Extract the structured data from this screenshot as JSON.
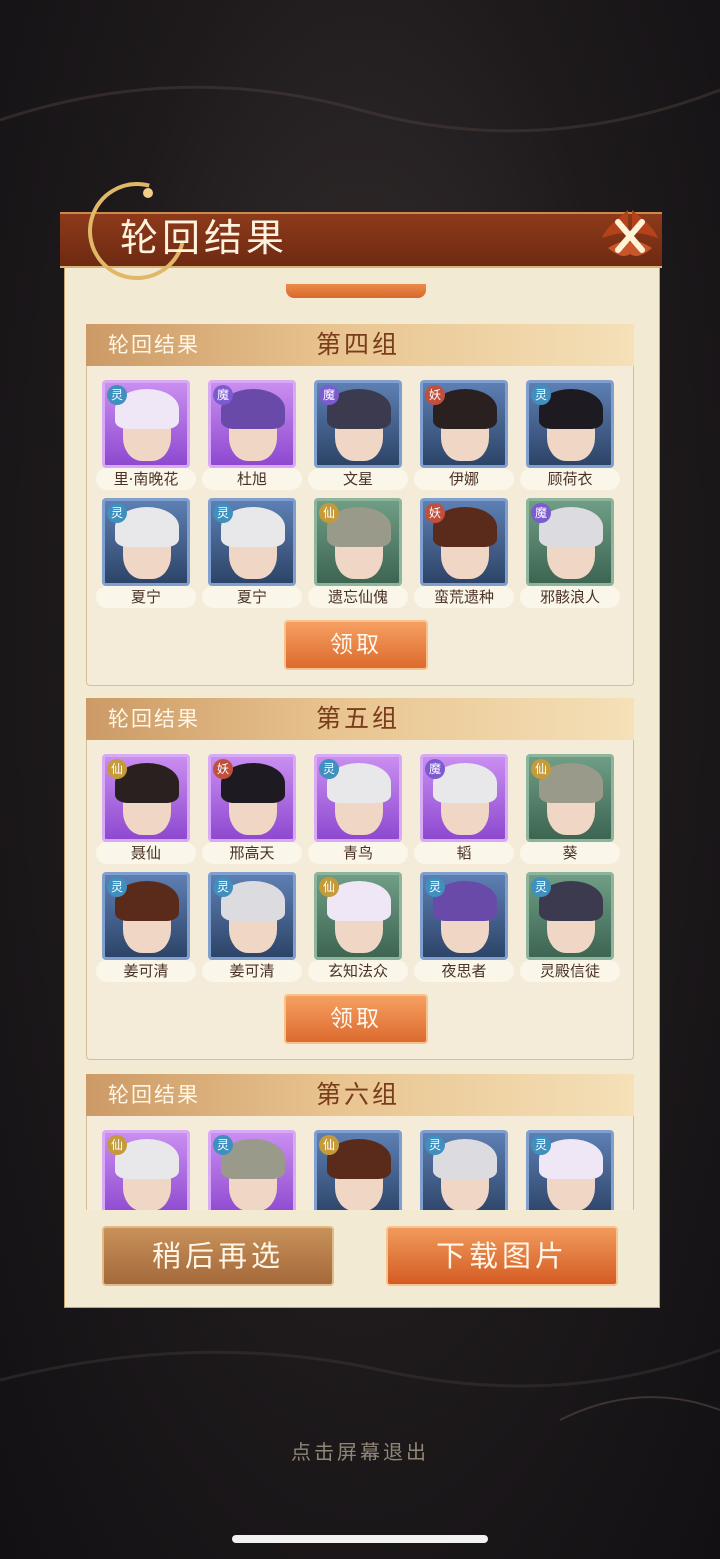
{
  "dialog": {
    "title": "轮回结果",
    "close_icon": "close-x-icon"
  },
  "groups": [
    {
      "label": "轮回结果",
      "number": "第四组",
      "claim_label": "领取",
      "cards": [
        {
          "name": "里·南晚花",
          "faction": "灵",
          "rarity": "purple"
        },
        {
          "name": "杜旭",
          "faction": "魔",
          "rarity": "purple"
        },
        {
          "name": "文星",
          "faction": "魔",
          "rarity": "blue"
        },
        {
          "name": "伊娜",
          "faction": "妖",
          "rarity": "blue"
        },
        {
          "name": "顾荷衣",
          "faction": "灵",
          "rarity": "blue"
        },
        {
          "name": "夏宁",
          "faction": "灵",
          "rarity": "blue"
        },
        {
          "name": "夏宁",
          "faction": "灵",
          "rarity": "blue"
        },
        {
          "name": "遗忘仙傀",
          "faction": "仙",
          "rarity": "green"
        },
        {
          "name": "蛮荒遗种",
          "faction": "妖",
          "rarity": "blue"
        },
        {
          "name": "邪骸浪人",
          "faction": "魔",
          "rarity": "green"
        }
      ]
    },
    {
      "label": "轮回结果",
      "number": "第五组",
      "claim_label": "领取",
      "cards": [
        {
          "name": "聂仙",
          "faction": "仙",
          "rarity": "purple"
        },
        {
          "name": "邢高天",
          "faction": "妖",
          "rarity": "purple"
        },
        {
          "name": "青鸟",
          "faction": "灵",
          "rarity": "purple"
        },
        {
          "name": "韬",
          "faction": "魔",
          "rarity": "purple"
        },
        {
          "name": "葵",
          "faction": "仙",
          "rarity": "green"
        },
        {
          "name": "姜可清",
          "faction": "灵",
          "rarity": "blue"
        },
        {
          "name": "姜可清",
          "faction": "灵",
          "rarity": "blue"
        },
        {
          "name": "玄知法众",
          "faction": "仙",
          "rarity": "green"
        },
        {
          "name": "夜思者",
          "faction": "灵",
          "rarity": "blue"
        },
        {
          "name": "灵殿信徒",
          "faction": "灵",
          "rarity": "green"
        }
      ]
    },
    {
      "label": "轮回结果",
      "number": "第六组",
      "claim_label": "",
      "cards": [
        {
          "name": "",
          "faction": "仙",
          "rarity": "purple"
        },
        {
          "name": "",
          "faction": "灵",
          "rarity": "purple"
        },
        {
          "name": "",
          "faction": "仙",
          "rarity": "blue"
        },
        {
          "name": "",
          "faction": "灵",
          "rarity": "blue"
        },
        {
          "name": "",
          "faction": "灵",
          "rarity": "blue"
        }
      ]
    }
  ],
  "buttons": {
    "later": "稍后再选",
    "download": "下载图片"
  },
  "exit_hint": "点击屏幕退出"
}
